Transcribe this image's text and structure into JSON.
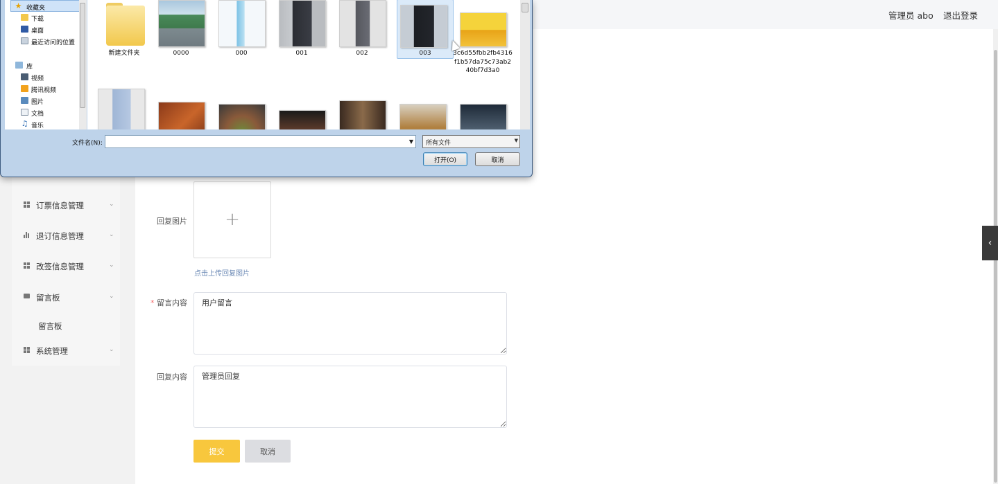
{
  "header": {
    "user_label": "管理员 abo",
    "logout_label": "退出登录"
  },
  "sidebar": {
    "items": [
      {
        "label": "订票信息管理",
        "icon": "grid-icon"
      },
      {
        "label": "退订信息管理",
        "icon": "bar-chart-icon"
      },
      {
        "label": "改签信息管理",
        "icon": "grid-icon"
      },
      {
        "label": "留言板",
        "icon": "message-board-icon"
      },
      {
        "label": "系统管理",
        "icon": "grid-icon"
      }
    ],
    "submenu_label": "留言板"
  },
  "form": {
    "reply_image_label": "回复图片",
    "upload_tip": "点击上传回复图片",
    "message_label": "留言内容",
    "message_value": "用户留言",
    "reply_label": "回复内容",
    "reply_value": "管理员回复",
    "submit_label": "提交",
    "cancel_label": "取消"
  },
  "dialog": {
    "nav": [
      {
        "label": "收藏夹",
        "icon": "star-icon"
      },
      {
        "label": "下载",
        "icon": "download-folder-icon"
      },
      {
        "label": "桌面",
        "icon": "desktop-icon"
      },
      {
        "label": "最近访问的位置",
        "icon": "recent-places-icon"
      },
      {
        "label": "库",
        "icon": "library-icon"
      },
      {
        "label": "视频",
        "icon": "video-icon"
      },
      {
        "label": "腾讯视频",
        "icon": "tencent-video-icon"
      },
      {
        "label": "图片",
        "icon": "pictures-icon"
      },
      {
        "label": "文档",
        "icon": "documents-icon"
      },
      {
        "label": "音乐",
        "icon": "music-icon"
      }
    ],
    "files": [
      {
        "name": "新建文件夹"
      },
      {
        "name": "0000"
      },
      {
        "name": "000"
      },
      {
        "name": "001"
      },
      {
        "name": "002"
      },
      {
        "name": "003",
        "selected": true
      },
      {
        "name": "3c6d55fbb2fb4316f1b57da75c73ab240bf7d3a0"
      }
    ],
    "filename_label": "文件名(N):",
    "filename_value": "",
    "filetype_value": "所有文件",
    "open_label": "打开(O)",
    "cancel_label": "取消"
  },
  "colors": {
    "accent": "#f8c73d",
    "sidebar_bg": "#f6f6f6",
    "dialog_frame": "#bed3ea"
  }
}
